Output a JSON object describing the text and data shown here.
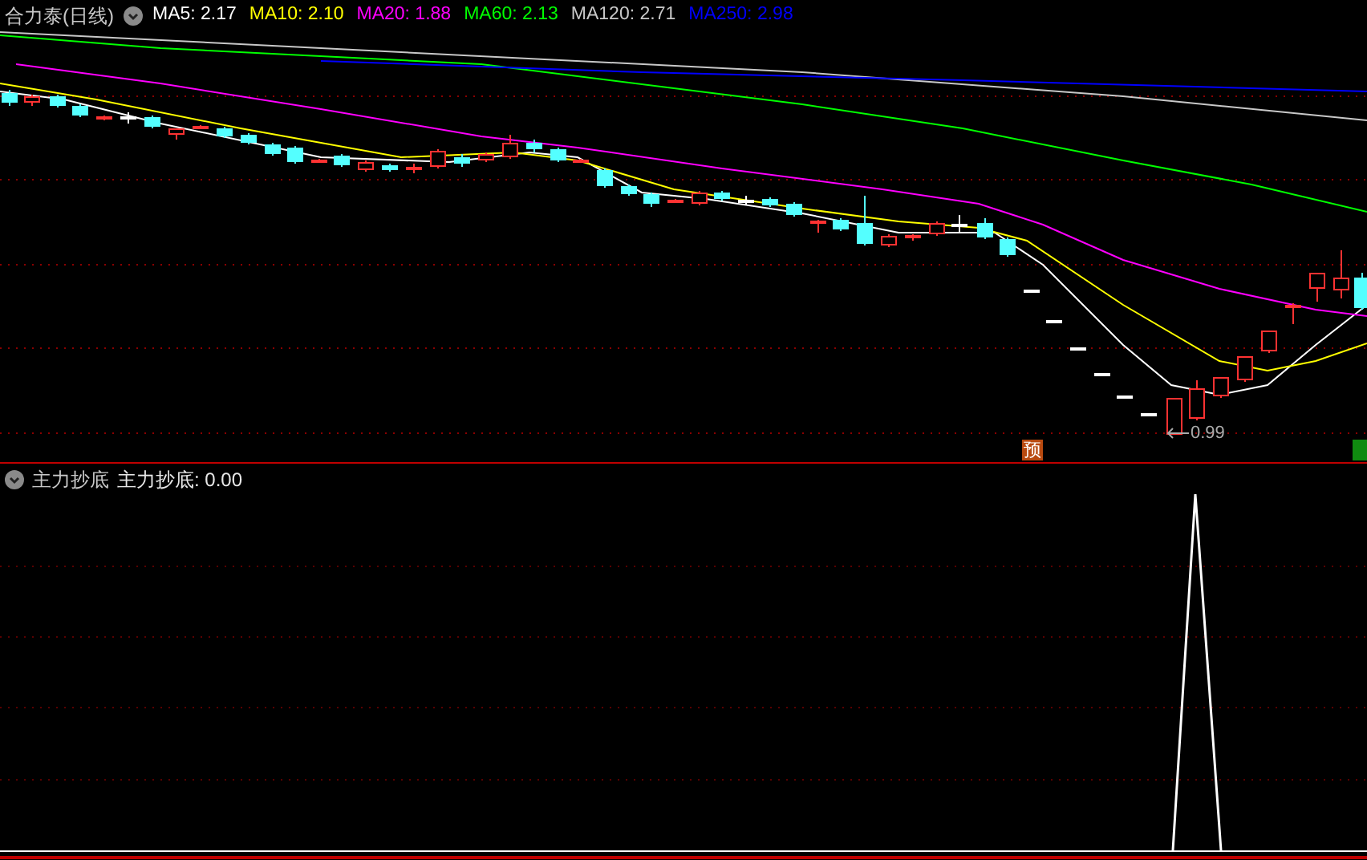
{
  "main_panel": {
    "title": "合力泰(日线)",
    "moving_averages": [
      {
        "label": "MA5: 2.17",
        "color": "#ffffff"
      },
      {
        "label": "MA10: 2.10",
        "color": "#ffff00"
      },
      {
        "label": "MA20: 1.88",
        "color": "#ff00ff"
      },
      {
        "label": "MA60: 2.13",
        "color": "#00ff00"
      },
      {
        "label": "MA120: 2.71",
        "color": "#c8c8c8"
      },
      {
        "label": "MA250: 2.98",
        "color": "#0000ff"
      }
    ],
    "low_marker": "0.99",
    "signal_badge": "预"
  },
  "indicator_panel": {
    "title": "主力抄底",
    "legend": "主力抄底: 0.00"
  }
}
